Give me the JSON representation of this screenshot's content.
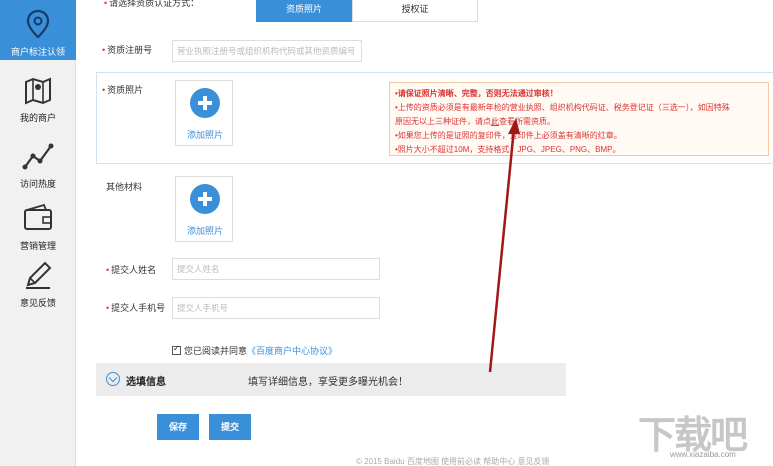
{
  "sidebar": {
    "items": [
      {
        "label": "商户标注认领",
        "icon": "location-pin-icon",
        "active": true
      },
      {
        "label": "我的商户",
        "icon": "map-icon",
        "active": false
      },
      {
        "label": "访问热度",
        "icon": "line-trend-icon",
        "active": false
      },
      {
        "label": "营销管理",
        "icon": "wallet-icon",
        "active": false
      },
      {
        "label": "意见反馈",
        "icon": "pencil-icon",
        "active": false
      }
    ]
  },
  "form": {
    "top_row_label": "请选择资质认证方式：",
    "top_tabs": [
      "资质照片",
      "授权证"
    ],
    "reg_label": "资质注册号",
    "reg_placeholder": "营业执照注册号或组织机构代码或其他资质编号",
    "photo_label": "资质照片",
    "photo_upload": "添加照片",
    "other_label": "其他材料",
    "other_upload": "添加照片",
    "name_label": "提交人姓名",
    "name_placeholder": "提交人姓名",
    "phone_label": "提交人手机号",
    "phone_placeholder": "提交人手机号",
    "agree_prefix": "您已阅读并同意",
    "agree_link": "《百度商户中心协议》"
  },
  "notice": {
    "line1": "•请保证照片清晰、完整，否则无法通过审核！",
    "line2": "•上传的资质必须是有最新年检的营业执照、组织机构代码证、税务登记证（三选一），如因特殊",
    "line3_prefix": "原因无以上三种证件，请点",
    "line3_link": "此",
    "line3_suffix": "查看所需资质。",
    "line4": "•如果您上传的是证照的复印件，复印件上必须盖有清晰的红章。",
    "line5": "•照片大小不超过10M，支持格式：JPG、JPEG、PNG、BMP。"
  },
  "options": {
    "title": "选填信息",
    "hint": "填写详细信息，享受更多曝光机会！"
  },
  "buttons": {
    "save": "保存",
    "submit": "提交"
  },
  "footer": "© 2015 Baidu  百度地图   使用前必读   帮助中心   意见反馈",
  "watermark": {
    "text": "下载吧",
    "url": "www.xiazaiba.com"
  },
  "colors": {
    "accent": "#3a8fd9",
    "warning_text": "#dd3333",
    "arrow": "#a01818"
  }
}
